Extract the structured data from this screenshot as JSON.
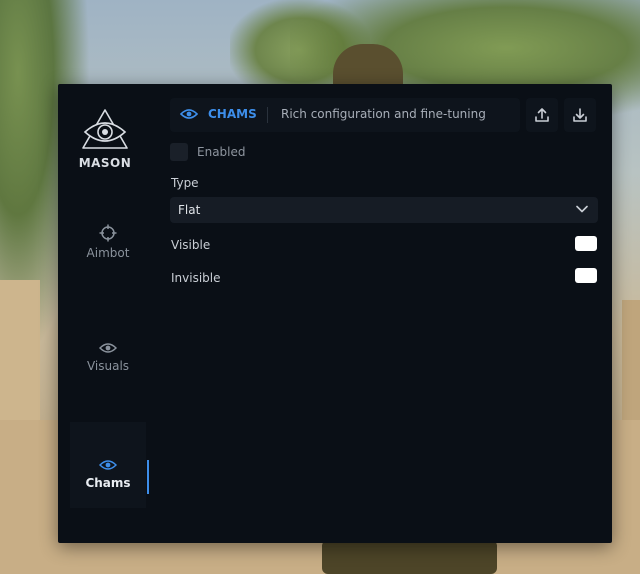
{
  "brand": {
    "name": "MASON"
  },
  "nav": {
    "items": [
      {
        "label": "Aimbot",
        "icon": "crosshair-icon"
      },
      {
        "label": "Visuals",
        "icon": "eye-icon"
      },
      {
        "label": "Chams",
        "icon": "eye-icon",
        "active": true
      }
    ]
  },
  "header": {
    "section": "CHAMS",
    "description": "Rich configuration and fine-tuning",
    "actions": [
      "upload-icon",
      "download-icon"
    ]
  },
  "settings": {
    "enabled": {
      "label": "Enabled",
      "checked": false
    },
    "type": {
      "label": "Type",
      "value": "Flat"
    },
    "visible": {
      "label": "Visible",
      "color": "#ffffff"
    },
    "invisible": {
      "label": "Invisible",
      "color": "#ffffff"
    }
  },
  "colors": {
    "accent": "#3d8eea",
    "panel": "#0a0f16",
    "surface": "#0e141c"
  }
}
